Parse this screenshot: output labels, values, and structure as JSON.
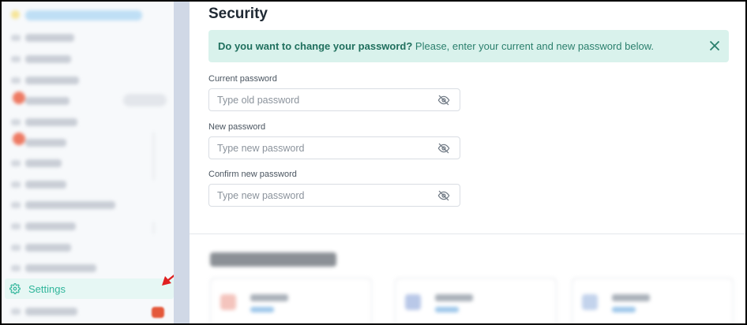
{
  "sidebar": {
    "settings_label": "Settings",
    "active_item": "Settings",
    "accent_color": "#2fb59a"
  },
  "main": {
    "title": "Security",
    "alert": {
      "bold": "Do you want to change your password?",
      "text": " Please, enter your current and new password below."
    },
    "fields": [
      {
        "label": "Current password",
        "placeholder": "Type old password",
        "icon": "eye-off-icon"
      },
      {
        "label": "New password",
        "placeholder": "Type new password",
        "icon": "eye-off-icon"
      },
      {
        "label": "Confirm new password",
        "placeholder": "Type new password",
        "icon": "eye-off-icon"
      }
    ]
  },
  "colors": {
    "alert_bg": "#d9f2ec",
    "alert_text": "#2a7f6c",
    "annotation_arrow": "#e02020"
  }
}
